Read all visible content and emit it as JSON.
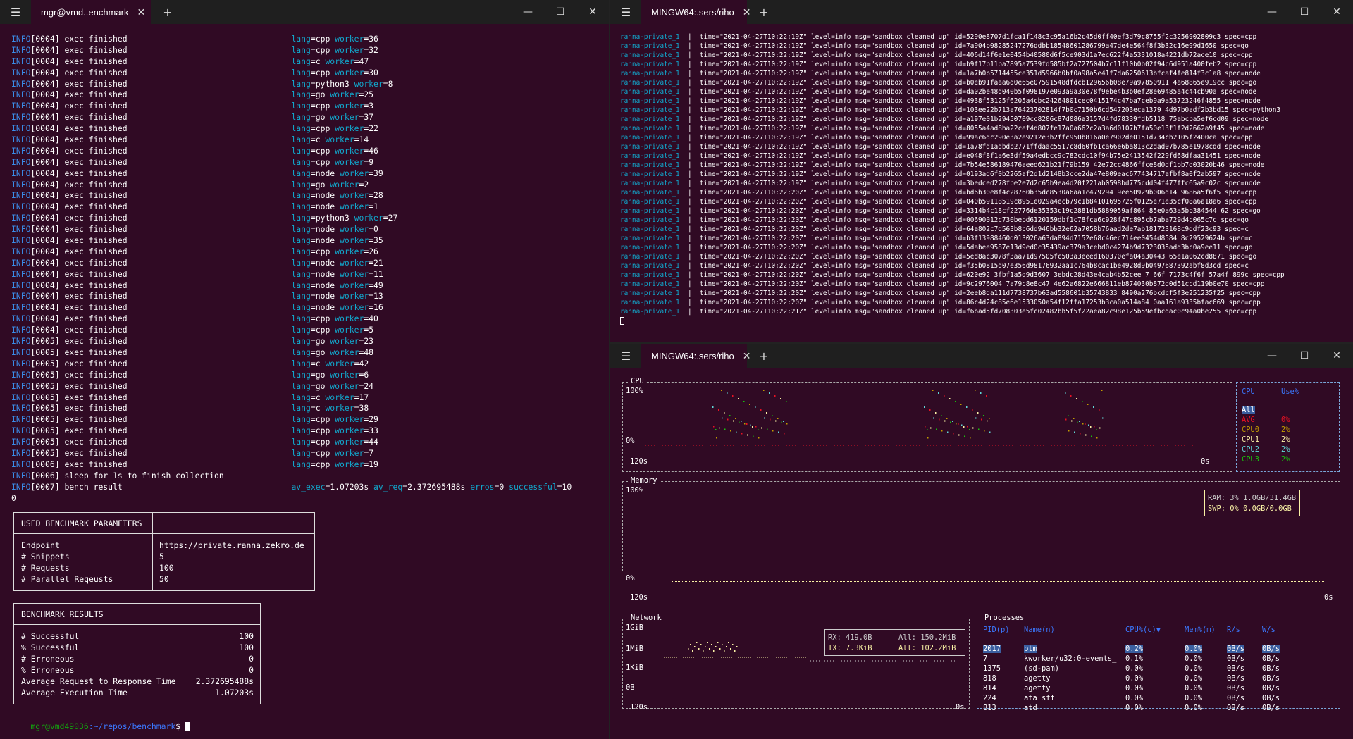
{
  "left_window": {
    "tab_title": "mgr@vmd..enchmark",
    "lines": [
      {
        "info": "INFO",
        "msg": "[0004] exec finished",
        "lang": "cpp",
        "worker": "36"
      },
      {
        "info": "INFO",
        "msg": "[0004] exec finished",
        "lang": "cpp",
        "worker": "32"
      },
      {
        "info": "INFO",
        "msg": "[0004] exec finished",
        "lang": "c",
        "worker": "47"
      },
      {
        "info": "INFO",
        "msg": "[0004] exec finished",
        "lang": "cpp",
        "worker": "30"
      },
      {
        "info": "INFO",
        "msg": "[0004] exec finished",
        "lang": "python3",
        "worker": "8"
      },
      {
        "info": "INFO",
        "msg": "[0004] exec finished",
        "lang": "go",
        "worker": "25"
      },
      {
        "info": "INFO",
        "msg": "[0004] exec finished",
        "lang": "cpp",
        "worker": "3"
      },
      {
        "info": "INFO",
        "msg": "[0004] exec finished",
        "lang": "go",
        "worker": "37"
      },
      {
        "info": "INFO",
        "msg": "[0004] exec finished",
        "lang": "cpp",
        "worker": "22"
      },
      {
        "info": "INFO",
        "msg": "[0004] exec finished",
        "lang": "c",
        "worker": "14"
      },
      {
        "info": "INFO",
        "msg": "[0004] exec finished",
        "lang": "cpp",
        "worker": "46"
      },
      {
        "info": "INFO",
        "msg": "[0004] exec finished",
        "lang": "cpp",
        "worker": "9"
      },
      {
        "info": "INFO",
        "msg": "[0004] exec finished",
        "lang": "node",
        "worker": "39"
      },
      {
        "info": "INFO",
        "msg": "[0004] exec finished",
        "lang": "go",
        "worker": "2"
      },
      {
        "info": "INFO",
        "msg": "[0004] exec finished",
        "lang": "node",
        "worker": "28"
      },
      {
        "info": "INFO",
        "msg": "[0004] exec finished",
        "lang": "node",
        "worker": "1"
      },
      {
        "info": "INFO",
        "msg": "[0004] exec finished",
        "lang": "python3",
        "worker": "27"
      },
      {
        "info": "INFO",
        "msg": "[0004] exec finished",
        "lang": "node",
        "worker": "0"
      },
      {
        "info": "INFO",
        "msg": "[0004] exec finished",
        "lang": "node",
        "worker": "35"
      },
      {
        "info": "INFO",
        "msg": "[0004] exec finished",
        "lang": "cpp",
        "worker": "26"
      },
      {
        "info": "INFO",
        "msg": "[0004] exec finished",
        "lang": "node",
        "worker": "21"
      },
      {
        "info": "INFO",
        "msg": "[0004] exec finished",
        "lang": "node",
        "worker": "11"
      },
      {
        "info": "INFO",
        "msg": "[0004] exec finished",
        "lang": "node",
        "worker": "49"
      },
      {
        "info": "INFO",
        "msg": "[0004] exec finished",
        "lang": "node",
        "worker": "13"
      },
      {
        "info": "INFO",
        "msg": "[0004] exec finished",
        "lang": "node",
        "worker": "16"
      },
      {
        "info": "INFO",
        "msg": "[0004] exec finished",
        "lang": "cpp",
        "worker": "40"
      },
      {
        "info": "INFO",
        "msg": "[0004] exec finished",
        "lang": "cpp",
        "worker": "5"
      },
      {
        "info": "INFO",
        "msg": "[0005] exec finished",
        "lang": "go",
        "worker": "23"
      },
      {
        "info": "INFO",
        "msg": "[0005] exec finished",
        "lang": "go",
        "worker": "48"
      },
      {
        "info": "INFO",
        "msg": "[0005] exec finished",
        "lang": "c",
        "worker": "42"
      },
      {
        "info": "INFO",
        "msg": "[0005] exec finished",
        "lang": "go",
        "worker": "6"
      },
      {
        "info": "INFO",
        "msg": "[0005] exec finished",
        "lang": "go",
        "worker": "24"
      },
      {
        "info": "INFO",
        "msg": "[0005] exec finished",
        "lang": "c",
        "worker": "17"
      },
      {
        "info": "INFO",
        "msg": "[0005] exec finished",
        "lang": "c",
        "worker": "38"
      },
      {
        "info": "INFO",
        "msg": "[0005] exec finished",
        "lang": "cpp",
        "worker": "29"
      },
      {
        "info": "INFO",
        "msg": "[0005] exec finished",
        "lang": "cpp",
        "worker": "33"
      },
      {
        "info": "INFO",
        "msg": "[0005] exec finished",
        "lang": "cpp",
        "worker": "44"
      },
      {
        "info": "INFO",
        "msg": "[0005] exec finished",
        "lang": "cpp",
        "worker": "7"
      },
      {
        "info": "INFO",
        "msg": "[0006] exec finished",
        "lang": "cpp",
        "worker": "19"
      }
    ],
    "sleep_line": "[0006] sleep for 1s to finish collection",
    "bench_line": "[0007] bench result",
    "bench_stats": {
      "av_exec": "1.07203s",
      "av_req": "2.372695488s",
      "erros": "0",
      "successful": "10"
    },
    "zero_line": "0",
    "params_table": {
      "title": "USED BENCHMARK PARAMETERS",
      "rows": [
        {
          "k": "Endpoint",
          "v": "https://private.ranna.zekro.de"
        },
        {
          "k": "# Snippets",
          "v": "5"
        },
        {
          "k": "# Requests",
          "v": "100"
        },
        {
          "k": "# Parallel Reqeusts",
          "v": "50"
        }
      ]
    },
    "results_table": {
      "title": "BENCHMARK RESULTS",
      "rows": [
        {
          "k": "# Successful",
          "v": "100"
        },
        {
          "k": "% Successful",
          "v": "100"
        },
        {
          "k": "# Erroneous",
          "v": "0"
        },
        {
          "k": "% Erroneous",
          "v": "0"
        },
        {
          "k": "Average Request to Response Time",
          "v": "2.372695488s"
        },
        {
          "k": "Average Execution Time",
          "v": "1.07203s"
        }
      ]
    },
    "prompt_user": "mgr@vmd49036",
    "prompt_path": ":~/repos/benchmark",
    "prompt_sym": "$"
  },
  "top_right_window": {
    "tab_title": "MINGW64:.sers/riho",
    "container": "ranna-private_1",
    "logs": [
      {
        "t": "2021-04-27T10:22:19Z",
        "id": "5290e8707d1fca1f148c3c95a16b2c45d0ff40ef3d79c8755f2c3256902809c3",
        "spec": "cpp"
      },
      {
        "t": "2021-04-27T10:22:19Z",
        "id": "7a904b08285247276ddbb18548601286799a47de4e564f8f3b32c16e99d1650",
        "spec": "go"
      },
      {
        "t": "2021-04-27T10:22:19Z",
        "id": "406d14f6e1e0454b40580d6f5ce903d1a7ec622f4a5331018a4221db72ace10",
        "spec": "cpp"
      },
      {
        "t": "2021-04-27T10:22:19Z",
        "id": "b9f17b11ba7895a7539fd585bf2a727504b7c11f10b0b02f94c6d951a400feb2",
        "spec": "cpp"
      },
      {
        "t": "2021-04-27T10:22:19Z",
        "id": "1a7b0b5714455ce351d5966b0bf0a98a5e41f7da6250613bfcaf4fe814f3c1a8",
        "spec": "node"
      },
      {
        "t": "2021-04-27T10:22:19Z",
        "id": "b0eb91faaa6d0e65e07591548dfdcb129656b08e79a97850911 4a68865e919cc",
        "spec": "go"
      },
      {
        "t": "2021-04-27T10:22:19Z",
        "id": "da02be48d040b5f098197e093a9a30e78f9ebe4b3b0ef28e69485a4c44cb90a",
        "spec": "node"
      },
      {
        "t": "2021-04-27T10:22:19Z",
        "id": "4938f53125f6205a4cbc24264801cec0415174c47ba7ceb9a9a53723246f4855",
        "spec": "node"
      },
      {
        "t": "2021-04-27T10:22:19Z",
        "id": "103ee22b713a76423702814f7b0c7150b6cd547203eca1379 4d97b0adf2b3bd15",
        "spec": "python3"
      },
      {
        "t": "2021-04-27T10:22:19Z",
        "id": "a197e01b29450709cc8206c87d086a3157d4fd78339fdb5118 75abcba5ef6cd09",
        "spec": "node"
      },
      {
        "t": "2021-04-27T10:22:19Z",
        "id": "8055a4ad8ba22cef4d807fe17a0a662c2a3a6d0107b7fa50e13f1f2d2662a9f45",
        "spec": "node"
      },
      {
        "t": "2021-04-27T10:22:19Z",
        "id": "99ac6dc290e3a2e9212e3b2ffc950b816a0e7902de0151d734cb2105f2400ca",
        "spec": "cpp"
      },
      {
        "t": "2021-04-27T10:22:19Z",
        "id": "1a78fd1adbdb2771ffdaac5517c8d60fb1ca66e6ba813c2dad07b785e1978cdd",
        "spec": "node"
      },
      {
        "t": "2021-04-27T10:22:19Z",
        "id": "e048f8f1a6e3df59a4edbcc9c782cdc10f94b75e2413542f229fd68dfaa31451",
        "spec": "node"
      },
      {
        "t": "2021-04-27T10:22:19Z",
        "id": "7b54e586189476aeed621b21f79b159 42e72cc4866ffce8d0df1bb7d03020b46",
        "spec": "node"
      },
      {
        "t": "2021-04-27T10:22:19Z",
        "id": "0193ad6f0b2265af2d1d2148b3cce2da47e809eac677434717afbf8a0f2ab597",
        "spec": "node"
      },
      {
        "t": "2021-04-27T10:22:19Z",
        "id": "3bedced278fbe2e7d2c65b9ea4d20f221ab0598bd775cdd04f477ffc65a9c02c",
        "spec": "node"
      },
      {
        "t": "2021-04-27T10:22:20Z",
        "id": "bd6b30e8f4c28760b35dc8530a6aa1c479294 9ee50929b006d14 9686a5f6f5",
        "spec": "cpp"
      },
      {
        "t": "2021-04-27T10:22:20Z",
        "id": "040b59118519c8951e029a4ecb79c1b84101695725f0125e71e35cf08a6a18a6",
        "spec": "cpp"
      },
      {
        "t": "2021-04-27T10:22:20Z",
        "id": "3314b4c18cf22776de35353c19c2881db5889059af864 85e0a63a5bb384544 62",
        "spec": "go"
      },
      {
        "t": "2021-04-27T10:22:20Z",
        "id": "00690012c730bebd6120159dbf1c78fca6c928f47c895cb7aba729d4c065c7c",
        "spec": "go"
      },
      {
        "t": "2021-04-27T10:22:20Z",
        "id": "64a802c7d563b8c6dd946bb32e62a7058b76aad2de7ab181723168c9ddf23c93",
        "spec": "c"
      },
      {
        "t": "2021-04-27T10:22:20Z",
        "id": "b3f13988460d013026a63da894d7152e68c46ec714ee0454d8584 8c29529624b",
        "spec": "c"
      },
      {
        "t": "2021-04-27T10:22:20Z",
        "id": "5dabee9587e13d9ed0c35439ac379a3cebd0c4274b9d7323035add3bc0a9ee11",
        "spec": "go"
      },
      {
        "t": "2021-04-27T10:22:20Z",
        "id": "5ed8ac3078f3aa71d97505fc503a3eeed160370efa04a30443 65e1a062cd8871",
        "spec": "go"
      },
      {
        "t": "2021-04-27T10:22:20Z",
        "id": "f35b0815d07e356d98176932aa1c764b8cac1be4928d9b0497687392abf8d3cd",
        "spec": "c"
      },
      {
        "t": "2021-04-27T10:22:20Z",
        "id": "620e92 3fbf1a5d9d3607 3ebdc28d43e4cab4b52cee 7 66f 7173c4f6f 57a4f 899c",
        "spec": "cpp"
      },
      {
        "t": "2021-04-27T10:22:20Z",
        "id": "9c2976004 7a79c8e8c47 4e62a6822e666811eb874030b872d0d51ccd119b0e70",
        "spec": "cpp"
      },
      {
        "t": "2021-04-27T10:22:20Z",
        "id": "2eeb8da111d7738737b63ad558601b35743833 8490a276bcdcf5f3e251235f25",
        "spec": "cpp"
      },
      {
        "t": "2021-04-27T10:22:20Z",
        "id": "86c4d24c85e6e1533050a54f12ffa17253b3ca0a514a84 0aa161a9335bfac669",
        "spec": "cpp"
      },
      {
        "t": "2021-04-27T10:22:21Z",
        "id": "f6bad5fd708303e5fc02482bb5f5f22aea82c98e125b59efbcdac0c94a0be255",
        "spec": "cpp"
      }
    ]
  },
  "bottom_right_window": {
    "tab_title": "MINGW64:.sers/riho",
    "cpu": {
      "label": "CPU",
      "y_top": "100%",
      "y_bottom": "0%",
      "x_left": "120s",
      "x_right": "0s",
      "legend_header": [
        "CPU",
        "Use%"
      ],
      "legend": [
        {
          "name": "All",
          "val": "",
          "color": "#3b78ff"
        },
        {
          "name": "AVG",
          "val": "0%",
          "color": "#e81123"
        },
        {
          "name": "CPU0",
          "val": "2%",
          "color": "#c19c00"
        },
        {
          "name": "CPU1",
          "val": "2%",
          "color": "#f9f1a5"
        },
        {
          "name": "CPU2",
          "val": "2%",
          "color": "#61d6d6"
        },
        {
          "name": "CPU3",
          "val": "2%",
          "color": "#16c60c"
        }
      ]
    },
    "memory": {
      "label": "Memory",
      "y_top": "100%",
      "y_bottom": "0%",
      "x_left": "120s",
      "x_right": "0s",
      "ram_label": "RAM:",
      "ram_pct": "3%",
      "ram_val": "1.0GB/31.4GB",
      "swp_label": "SWP:",
      "swp_pct": "0%",
      "swp_val": "0.0GB/0.0GB"
    },
    "network": {
      "label": "Network",
      "y": [
        "1GiB",
        "1MiB",
        "1KiB",
        "0B"
      ],
      "x_left": "120s",
      "x_right": "0s",
      "rx_label": "RX: 419.0B",
      "rx_all": "All: 150.2MiB",
      "tx_label": "TX: 7.3KiB",
      "tx_all": "All: 102.2MiB"
    },
    "processes": {
      "label": "Processes",
      "headers": [
        "PID(p)",
        "Name(n)",
        "CPU%(c)▼",
        "Mem%(m)",
        "R/s",
        "W/s"
      ],
      "rows": [
        [
          "2017",
          "btm",
          "0.2%",
          "0.0%",
          "0B/s",
          "0B/s"
        ],
        [
          "7",
          "kworker/u32:0-events_",
          "0.1%",
          "0.0%",
          "0B/s",
          "0B/s"
        ],
        [
          "1375",
          "(sd-pam)",
          "0.0%",
          "0.0%",
          "0B/s",
          "0B/s"
        ],
        [
          "818",
          "agetty",
          "0.0%",
          "0.0%",
          "0B/s",
          "0B/s"
        ],
        [
          "814",
          "agetty",
          "0.0%",
          "0.0%",
          "0B/s",
          "0B/s"
        ],
        [
          "224",
          "ata_sff",
          "0.0%",
          "0.0%",
          "0B/s",
          "0B/s"
        ],
        [
          "813",
          "atd",
          "0.0%",
          "0.0%",
          "0B/s",
          "0B/s"
        ]
      ]
    }
  },
  "colors": {
    "bg": "#300a24",
    "info": "#3b8eea",
    "cyan": "#11a8cd",
    "green": "#13a10e",
    "yellow": "#f9f1a5",
    "red": "#e81123"
  }
}
